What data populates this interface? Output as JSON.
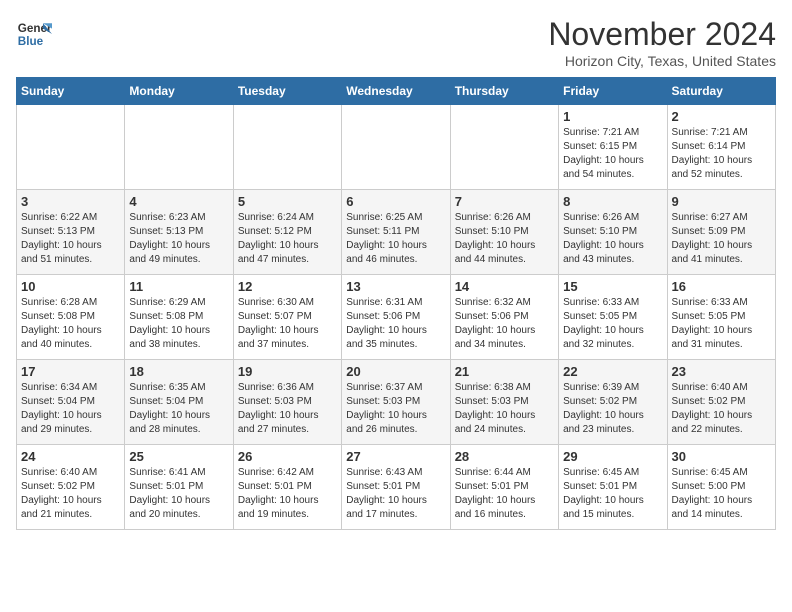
{
  "logo": {
    "line1": "General",
    "line2": "Blue"
  },
  "header": {
    "month": "November 2024",
    "location": "Horizon City, Texas, United States"
  },
  "weekdays": [
    "Sunday",
    "Monday",
    "Tuesday",
    "Wednesday",
    "Thursday",
    "Friday",
    "Saturday"
  ],
  "weeks": [
    [
      {
        "day": "",
        "info": ""
      },
      {
        "day": "",
        "info": ""
      },
      {
        "day": "",
        "info": ""
      },
      {
        "day": "",
        "info": ""
      },
      {
        "day": "",
        "info": ""
      },
      {
        "day": "1",
        "info": "Sunrise: 7:21 AM\nSunset: 6:15 PM\nDaylight: 10 hours and 54 minutes."
      },
      {
        "day": "2",
        "info": "Sunrise: 7:21 AM\nSunset: 6:14 PM\nDaylight: 10 hours and 52 minutes."
      }
    ],
    [
      {
        "day": "3",
        "info": "Sunrise: 6:22 AM\nSunset: 5:13 PM\nDaylight: 10 hours and 51 minutes."
      },
      {
        "day": "4",
        "info": "Sunrise: 6:23 AM\nSunset: 5:13 PM\nDaylight: 10 hours and 49 minutes."
      },
      {
        "day": "5",
        "info": "Sunrise: 6:24 AM\nSunset: 5:12 PM\nDaylight: 10 hours and 47 minutes."
      },
      {
        "day": "6",
        "info": "Sunrise: 6:25 AM\nSunset: 5:11 PM\nDaylight: 10 hours and 46 minutes."
      },
      {
        "day": "7",
        "info": "Sunrise: 6:26 AM\nSunset: 5:10 PM\nDaylight: 10 hours and 44 minutes."
      },
      {
        "day": "8",
        "info": "Sunrise: 6:26 AM\nSunset: 5:10 PM\nDaylight: 10 hours and 43 minutes."
      },
      {
        "day": "9",
        "info": "Sunrise: 6:27 AM\nSunset: 5:09 PM\nDaylight: 10 hours and 41 minutes."
      }
    ],
    [
      {
        "day": "10",
        "info": "Sunrise: 6:28 AM\nSunset: 5:08 PM\nDaylight: 10 hours and 40 minutes."
      },
      {
        "day": "11",
        "info": "Sunrise: 6:29 AM\nSunset: 5:08 PM\nDaylight: 10 hours and 38 minutes."
      },
      {
        "day": "12",
        "info": "Sunrise: 6:30 AM\nSunset: 5:07 PM\nDaylight: 10 hours and 37 minutes."
      },
      {
        "day": "13",
        "info": "Sunrise: 6:31 AM\nSunset: 5:06 PM\nDaylight: 10 hours and 35 minutes."
      },
      {
        "day": "14",
        "info": "Sunrise: 6:32 AM\nSunset: 5:06 PM\nDaylight: 10 hours and 34 minutes."
      },
      {
        "day": "15",
        "info": "Sunrise: 6:33 AM\nSunset: 5:05 PM\nDaylight: 10 hours and 32 minutes."
      },
      {
        "day": "16",
        "info": "Sunrise: 6:33 AM\nSunset: 5:05 PM\nDaylight: 10 hours and 31 minutes."
      }
    ],
    [
      {
        "day": "17",
        "info": "Sunrise: 6:34 AM\nSunset: 5:04 PM\nDaylight: 10 hours and 29 minutes."
      },
      {
        "day": "18",
        "info": "Sunrise: 6:35 AM\nSunset: 5:04 PM\nDaylight: 10 hours and 28 minutes."
      },
      {
        "day": "19",
        "info": "Sunrise: 6:36 AM\nSunset: 5:03 PM\nDaylight: 10 hours and 27 minutes."
      },
      {
        "day": "20",
        "info": "Sunrise: 6:37 AM\nSunset: 5:03 PM\nDaylight: 10 hours and 26 minutes."
      },
      {
        "day": "21",
        "info": "Sunrise: 6:38 AM\nSunset: 5:03 PM\nDaylight: 10 hours and 24 minutes."
      },
      {
        "day": "22",
        "info": "Sunrise: 6:39 AM\nSunset: 5:02 PM\nDaylight: 10 hours and 23 minutes."
      },
      {
        "day": "23",
        "info": "Sunrise: 6:40 AM\nSunset: 5:02 PM\nDaylight: 10 hours and 22 minutes."
      }
    ],
    [
      {
        "day": "24",
        "info": "Sunrise: 6:40 AM\nSunset: 5:02 PM\nDaylight: 10 hours and 21 minutes."
      },
      {
        "day": "25",
        "info": "Sunrise: 6:41 AM\nSunset: 5:01 PM\nDaylight: 10 hours and 20 minutes."
      },
      {
        "day": "26",
        "info": "Sunrise: 6:42 AM\nSunset: 5:01 PM\nDaylight: 10 hours and 19 minutes."
      },
      {
        "day": "27",
        "info": "Sunrise: 6:43 AM\nSunset: 5:01 PM\nDaylight: 10 hours and 17 minutes."
      },
      {
        "day": "28",
        "info": "Sunrise: 6:44 AM\nSunset: 5:01 PM\nDaylight: 10 hours and 16 minutes."
      },
      {
        "day": "29",
        "info": "Sunrise: 6:45 AM\nSunset: 5:01 PM\nDaylight: 10 hours and 15 minutes."
      },
      {
        "day": "30",
        "info": "Sunrise: 6:45 AM\nSunset: 5:00 PM\nDaylight: 10 hours and 14 minutes."
      }
    ]
  ]
}
